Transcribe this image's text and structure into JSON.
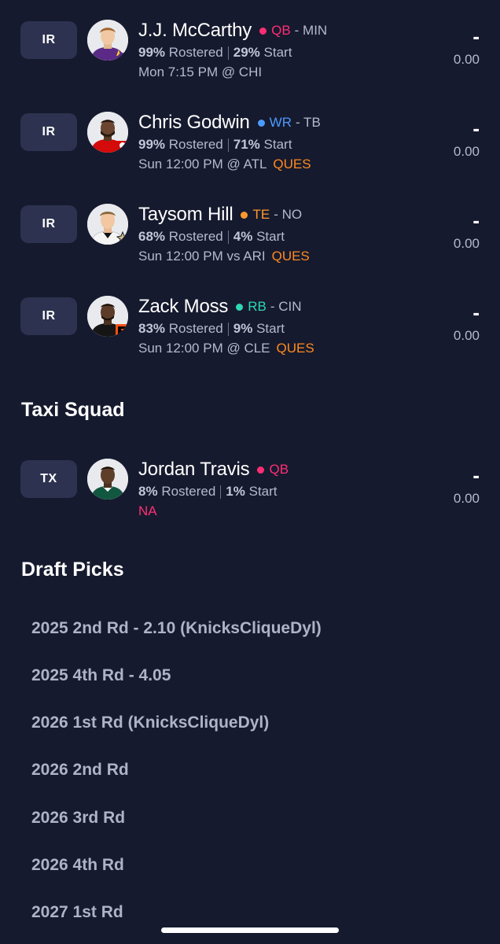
{
  "colors": {
    "background": "#161a2e",
    "badge_bg": "#2d3250",
    "qb": "#ff2e74",
    "wr": "#4a9bff",
    "te": "#ff9a2e",
    "rb": "#2ed8b6",
    "ques": "#ff8a1f",
    "na": "#ff2e74"
  },
  "players": [
    {
      "slot": "IR",
      "name": "J.J. McCarthy",
      "position": "QB",
      "team": "MIN",
      "team_separator": "- MIN",
      "rostered_pct": "99%",
      "rostered_label": "Rostered",
      "start_pct": "29%",
      "start_label": "Start",
      "game": "Mon 7:15 PM @ CHI",
      "status": "",
      "score_dash": "-",
      "score": "0.00",
      "avatar_icon": "player-headshot-icon",
      "team_logo_icon": "vikings-logo-icon"
    },
    {
      "slot": "IR",
      "name": "Chris Godwin",
      "position": "WR",
      "team": "TB",
      "team_separator": "- TB",
      "rostered_pct": "99%",
      "rostered_label": "Rostered",
      "start_pct": "71%",
      "start_label": "Start",
      "game": "Sun 12:00 PM @ ATL",
      "status": "QUES",
      "score_dash": "-",
      "score": "0.00",
      "avatar_icon": "player-headshot-icon",
      "team_logo_icon": "buccaneers-logo-icon"
    },
    {
      "slot": "IR",
      "name": "Taysom Hill",
      "position": "TE",
      "team": "NO",
      "team_separator": "- NO",
      "rostered_pct": "68%",
      "rostered_label": "Rostered",
      "start_pct": "4%",
      "start_label": "Start",
      "game": "Sun 12:00 PM vs ARI",
      "status": "QUES",
      "score_dash": "-",
      "score": "0.00",
      "avatar_icon": "player-headshot-icon",
      "team_logo_icon": "saints-logo-icon"
    },
    {
      "slot": "IR",
      "name": "Zack Moss",
      "position": "RB",
      "team": "CIN",
      "team_separator": "- CIN",
      "rostered_pct": "83%",
      "rostered_label": "Rostered",
      "start_pct": "9%",
      "start_label": "Start",
      "game": "Sun 12:00 PM @ CLE",
      "status": "QUES",
      "score_dash": "-",
      "score": "0.00",
      "avatar_icon": "player-headshot-icon",
      "team_logo_icon": "bengals-logo-icon"
    }
  ],
  "taxi_squad": {
    "title": "Taxi Squad",
    "players": [
      {
        "slot": "TX",
        "name": "Jordan Travis",
        "position": "QB",
        "rostered_pct": "8%",
        "rostered_label": "Rostered",
        "start_pct": "1%",
        "start_label": "Start",
        "status": "NA",
        "score_dash": "-",
        "score": "0.00",
        "avatar_icon": "player-headshot-icon"
      }
    ]
  },
  "draft_picks": {
    "title": "Draft Picks",
    "items": [
      "2025 2nd Rd - 2.10 (KnicksCliqueDyl)",
      "2025 4th Rd - 4.05",
      "2026 1st Rd (KnicksCliqueDyl)",
      "2026 2nd Rd",
      "2026 3rd Rd",
      "2026 4th Rd",
      "2027 1st Rd"
    ]
  }
}
